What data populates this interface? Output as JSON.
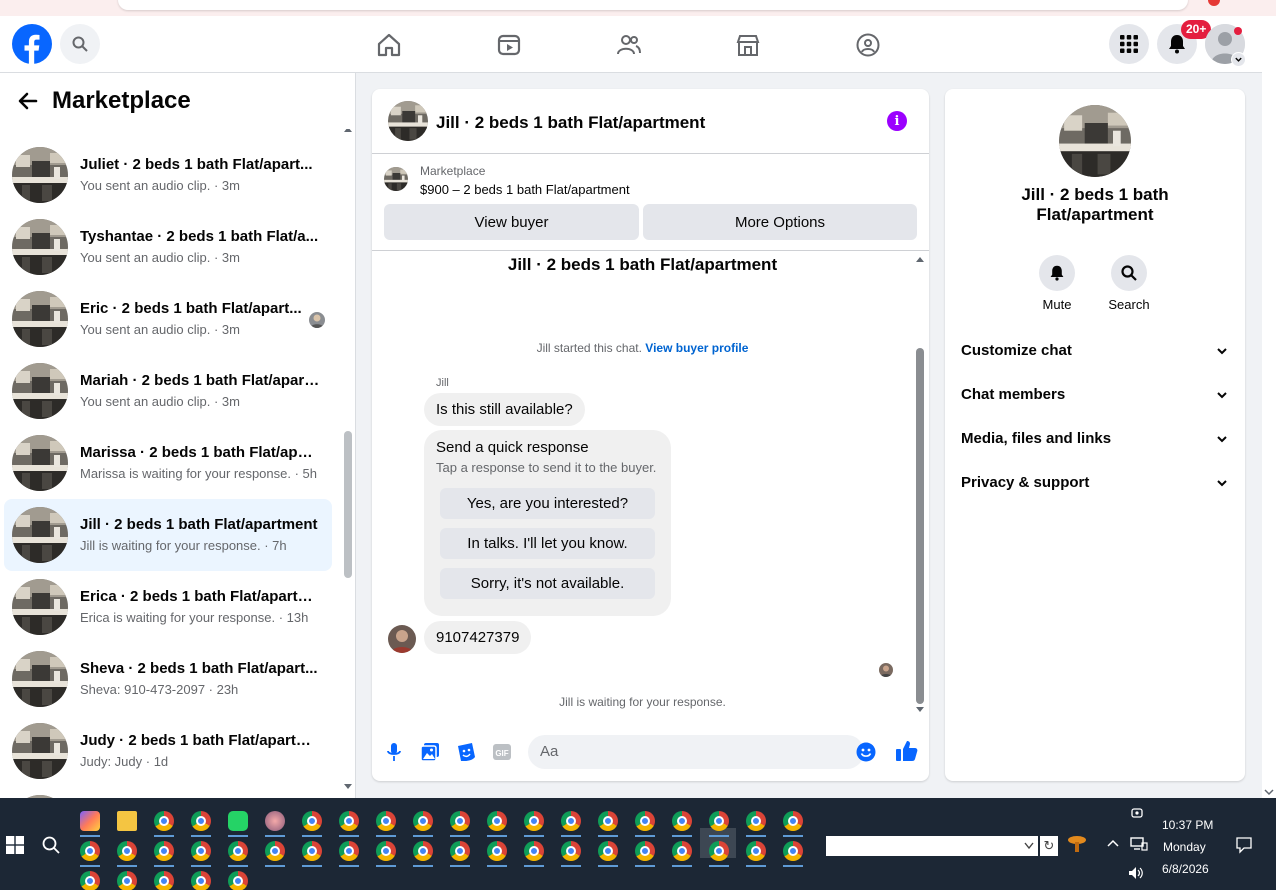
{
  "topnav": {
    "notifications_badge": "20+"
  },
  "sidebar": {
    "title": "Marketplace",
    "conversations": [
      {
        "title": "Juliet · 2 beds 1 bath Flat/apart...",
        "subtitle": "You sent an audio clip. · 3m",
        "active": false
      },
      {
        "title": "Tyshantae · 2 beds 1 bath Flat/a...",
        "subtitle": "You sent an audio clip. · 3m",
        "active": false
      },
      {
        "title": "Eric · 2 beds 1 bath Flat/apart...",
        "subtitle": "You sent an audio clip. · 3m",
        "active": false
      },
      {
        "title": "Mariah · 2 beds 1 bath Flat/apart...",
        "subtitle": "You sent an audio clip. · 3m",
        "active": false
      },
      {
        "title": "Marissa · 2 beds 1 bath Flat/apar...",
        "subtitle": "Marissa is waiting for your response. · 5h",
        "active": false
      },
      {
        "title": "Jill · 2 beds 1 bath Flat/apartment",
        "subtitle": "Jill is waiting for your response. · 7h",
        "active": true
      },
      {
        "title": "Erica · 2 beds 1 bath Flat/apartm...",
        "subtitle": "Erica is waiting for your response. · 13h",
        "active": false
      },
      {
        "title": "Sheva · 2 beds 1 bath Flat/apart...",
        "subtitle": "Sheva: 910-473-2097 · 23h",
        "active": false
      },
      {
        "title": "Judy · 2 beds 1 bath Flat/apartm...",
        "subtitle": "Judy: Judy · 1d",
        "active": false
      }
    ]
  },
  "chat": {
    "header_title": "Jill · 2 beds 1 bath Flat/apartment",
    "listing_label": "Marketplace",
    "listing_price": "$900 – 2 beds 1 bath Flat/apartment",
    "view_buyer_label": "View buyer",
    "more_options_label": "More Options",
    "thread_title": "Jill · 2 beds 1 bath Flat/apartment",
    "started_text": "Jill started this chat.",
    "view_profile_link": "View buyer profile",
    "sender_name": "Jill",
    "first_message": "Is this still available?",
    "quick_title": "Send a quick response",
    "quick_subtitle": "Tap a response to send it to the buyer.",
    "quick_responses": [
      "Yes, are you interested?",
      "In talks. I'll let you know.",
      "Sorry, it's not available."
    ],
    "phone_message": "9107427379",
    "waiting_text": "Jill is waiting for your response.",
    "input_placeholder": "Aa"
  },
  "details": {
    "title": "Jill · 2 beds 1 bath Flat/apartment",
    "mute_label": "Mute",
    "search_label": "Search",
    "sections": [
      "Customize chat",
      "Chat members",
      "Media, files and links",
      "Privacy & support"
    ]
  },
  "taskbar": {
    "time": "10:37 PM",
    "day": "Monday",
    "date": "6/8/2026"
  },
  "colors": {
    "brand_blue": "#0866ff",
    "accent_purple": "#9b00ff",
    "active_row": "#ebf5ff",
    "taskbar": "#1c2735"
  }
}
